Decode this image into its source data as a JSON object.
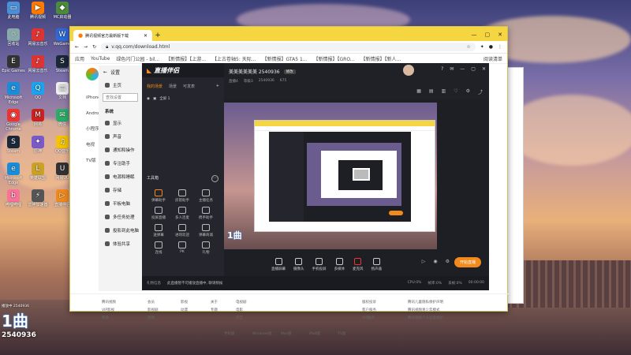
{
  "desktop": {
    "icons": [
      {
        "label": "此电脑",
        "color": "#4a90d9",
        "g": "▭"
      },
      {
        "label": "腾讯视频",
        "color": "#ff7a00",
        "g": "▶"
      },
      {
        "label": "MC启动器",
        "color": "#4a8c3c",
        "g": "◆"
      },
      {
        "label": "回收站",
        "color": "#8aa",
        "g": "♲"
      },
      {
        "label": "网易云音乐",
        "color": "#d33",
        "g": "♪"
      },
      {
        "label": "WeGame",
        "color": "#2c6ad9",
        "g": "W"
      },
      {
        "label": "Epic Games",
        "color": "#333",
        "g": "E"
      },
      {
        "label": "网易云音乐",
        "color": "#d33",
        "g": "♪"
      },
      {
        "label": "Steam",
        "color": "#1b2838",
        "g": "S"
      },
      {
        "label": "Microsoft Edge",
        "color": "#1a8cd8",
        "g": "e"
      },
      {
        "label": "QQ",
        "color": "#1aa3f0",
        "g": "Q"
      },
      {
        "label": "文档",
        "color": "#eee",
        "g": "▤"
      },
      {
        "label": "Google Chrome",
        "color": "#e33",
        "g": "◉"
      },
      {
        "label": "网易",
        "color": "#c22",
        "g": "M"
      },
      {
        "label": "微信",
        "color": "#2aae67",
        "g": "✉"
      },
      {
        "label": "Steam",
        "color": "#1b2838",
        "g": "S"
      },
      {
        "label": "原神",
        "color": "#7a5ac8",
        "g": "✦"
      },
      {
        "label": "QQ音乐",
        "color": "#f5c400",
        "g": "♫"
      },
      {
        "label": "Microsoft Edge",
        "color": "#1a8cd8",
        "g": "e"
      },
      {
        "label": "英雄联盟",
        "color": "#c9a227",
        "g": "L"
      },
      {
        "label": "网易UU",
        "color": "#333",
        "g": "U"
      },
      {
        "label": "哔哩哔哩",
        "color": "#fb7299",
        "g": "b"
      },
      {
        "label": "雷神加速器",
        "color": "#555",
        "g": "⚡"
      },
      {
        "label": "直播伴侣",
        "color": "#f28a1b",
        "g": "▷"
      }
    ],
    "overlay_score": "2540936",
    "overlay_label": "1曲",
    "overlay_small": "播放中 2540936"
  },
  "browser": {
    "tab_title": "腾讯视频官方最新版下载",
    "url": "v.qq.com/download.html",
    "bookmarks": [
      "应用",
      "YouTube",
      "绿色闪门公园 - bil...",
      "【新情报】【上游...",
      "【上古卷轴5: 天际...",
      "【新情报】GTA5 1...",
      "【新情报】【GRO...",
      "【新情报】【新人..."
    ],
    "reading_list": "阅读清单",
    "page": {
      "left_labels": [
        "iPhone",
        "Android",
        "小程序",
        "电视",
        "TV版"
      ],
      "footer_cols": [
        [
          "腾讯视频",
          "VIP影视",
          "帮助"
        ],
        [
          "会员",
          "影视剧",
          "游戏"
        ],
        [
          "影视",
          "动漫"
        ],
        [
          "关于",
          "专题"
        ],
        [
          "电视剧",
          "电影",
          "综艺"
        ]
      ],
      "footer_platforms": [
        "手机版",
        "Windows版",
        "Mac版",
        "iPad版",
        "TV版"
      ],
      "footer_right": [
        "版权投诉",
        "客户服务",
        "VIP服务"
      ],
      "footer_legal": [
        "腾讯儿童隐私保护声明",
        "腾讯视频青少年模式",
        "腾讯视频个人信息保护"
      ]
    }
  },
  "settings": {
    "title": "设置",
    "search_placeholder": "查找设置",
    "home": "主页",
    "section": "系统",
    "items": [
      "显示",
      "声音",
      "通知和操作",
      "专注助手",
      "电源和睡眠",
      "存储",
      "平板电脑",
      "多任务处理",
      "投影到此电脑",
      "体验共享"
    ]
  },
  "app": {
    "brand": "直播伴侣",
    "tabs": [
      "我的场景",
      "场景",
      "可发表"
    ],
    "scene_label": "全屏 1",
    "room_title": "美美美美美美 2540936",
    "room_tag": "修改",
    "room_stats": [
      "直播4",
      "等级3",
      "2540936",
      "675"
    ],
    "tools_title": "工具箱",
    "tools": [
      "弹幕助手",
      "房管助手",
      "主播任务",
      "投屏直播",
      "多人连麦",
      "携手助手",
      "送弹幕",
      "进场欢迎",
      "弹幕商城",
      "连线",
      "PK",
      "礼物"
    ],
    "bottom_buttons": [
      "直播屏幕",
      "摄像头",
      "手机投屏",
      "多媒体",
      "麦克风",
      "扬声器"
    ],
    "start_label": "开始直播",
    "status_left": "礼物信息",
    "status_msg": "此直播暂不可播放直播中, 聊请稍候",
    "status_right": [
      "CPU:0%",
      "帧率:0%",
      "丢帧:0%",
      "00:00:00"
    ]
  }
}
